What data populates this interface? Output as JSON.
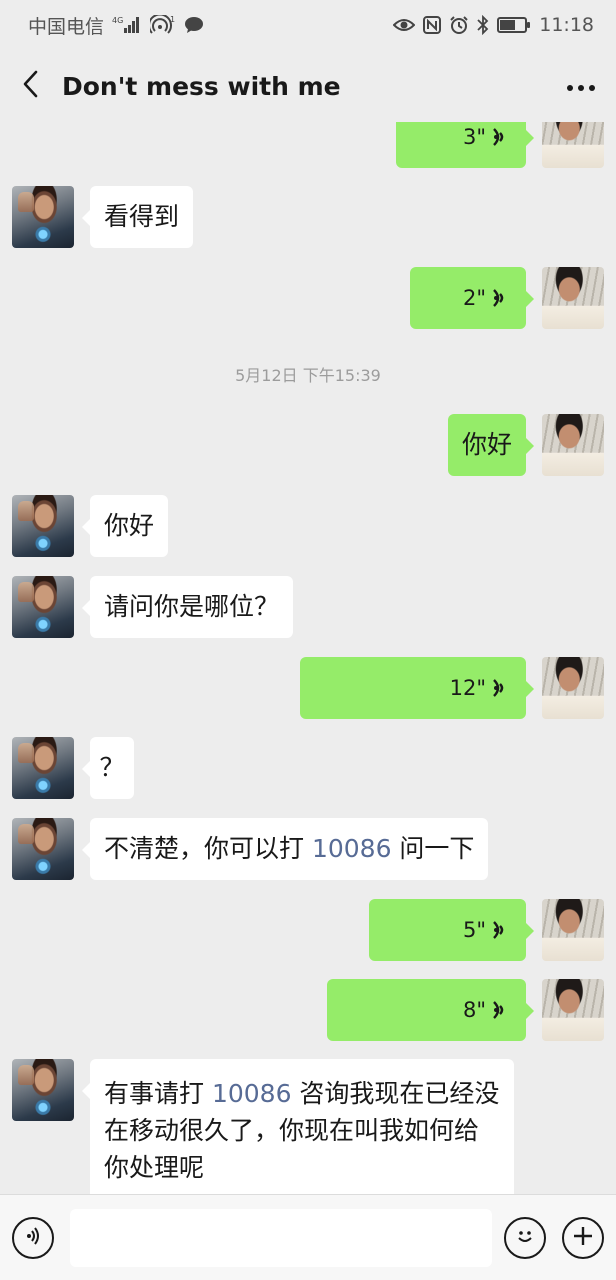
{
  "status_bar": {
    "carrier": "中国电信",
    "network": "4G",
    "notification_count": "1",
    "time": "11:18",
    "icons": [
      "signal-icon",
      "hotspot-icon",
      "chat-notification-icon",
      "eye-icon",
      "nfc-icon",
      "alarm-icon",
      "bluetooth-icon",
      "battery-icon"
    ],
    "battery_level": 0.55
  },
  "nav": {
    "title": "Don't mess with me",
    "back_icon": "chevron-left-icon",
    "more_icon": "more-dots-icon"
  },
  "messages": [
    {
      "side": "right",
      "type": "voice",
      "duration": "3\""
    },
    {
      "side": "left",
      "type": "text",
      "text": "看得到"
    },
    {
      "side": "right",
      "type": "voice",
      "duration": "2\""
    },
    {
      "type": "timestamp",
      "text": "5月12日 下午15:39"
    },
    {
      "side": "right",
      "type": "text",
      "text": "你好"
    },
    {
      "side": "left",
      "type": "text",
      "text": "你好"
    },
    {
      "side": "left",
      "type": "text",
      "text": "请问你是哪位？"
    },
    {
      "side": "right",
      "type": "voice",
      "duration": "12\""
    },
    {
      "side": "left",
      "type": "text",
      "text": "？"
    },
    {
      "side": "left",
      "type": "text",
      "text_before": "不清楚，你可以打 ",
      "link": "10086",
      "text_after": " 问一下"
    },
    {
      "side": "right",
      "type": "voice",
      "duration": "5\""
    },
    {
      "side": "right",
      "type": "voice",
      "duration": "8\""
    },
    {
      "side": "left",
      "type": "text",
      "text_before": "有事请打 ",
      "link": "10086",
      "text_after": " 咨询我现在已经没在移动很久了，你现在叫我如何给你处理呢"
    }
  ],
  "input_bar": {
    "voice_toggle_icon": "voice-mode-icon",
    "emoji_icon": "emoji-icon",
    "plus_icon": "plus-icon",
    "value": "",
    "placeholder": ""
  },
  "colors": {
    "background": "#ededed",
    "bubble_sent": "#95ec69",
    "bubble_received": "#ffffff",
    "link": "#576b95"
  }
}
